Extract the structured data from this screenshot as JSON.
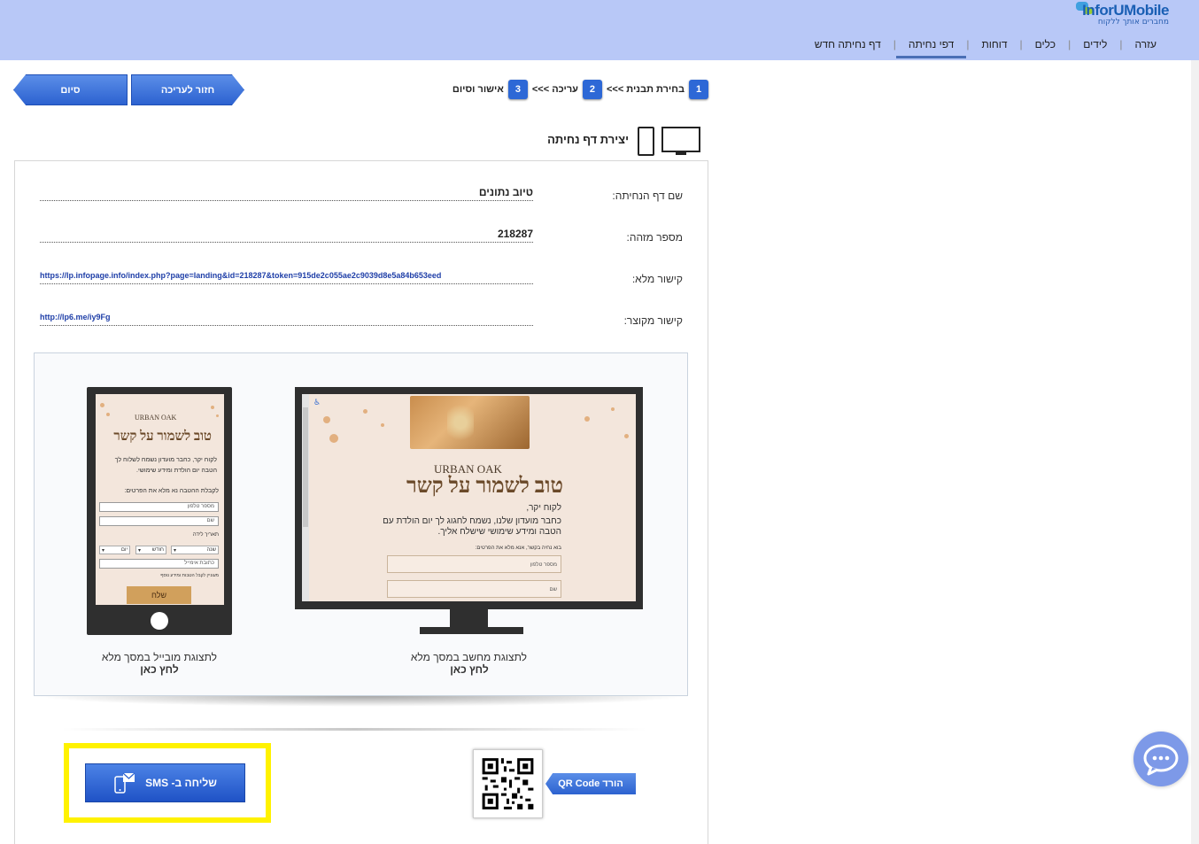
{
  "header": {
    "logo_text": "InforUMobile",
    "logo_sub": "מחברים אותך ללקוח",
    "nav": [
      {
        "label": "דף נחיתה חדש"
      },
      {
        "label": "דפי נחיתה",
        "active": true
      },
      {
        "label": "דוחות"
      },
      {
        "label": "כלים"
      },
      {
        "label": "לידים"
      },
      {
        "label": "עזרה"
      }
    ]
  },
  "toolbar": {
    "back_label": "חזור לעריכה",
    "finish_label": "סיום"
  },
  "steps": [
    {
      "num": "1",
      "label": "בחירת תבנית >>>"
    },
    {
      "num": "2",
      "label": "עריכה >>>"
    },
    {
      "num": "3",
      "label": "אישור וסיום"
    }
  ],
  "page_title": "יצירת דף נחיתה",
  "details": {
    "name_label": "שם דף הנחיתה:",
    "name_value": "טיוב נתונים",
    "id_label": "מספר מזהה:",
    "id_value": "218287",
    "full_link_label": "קישור מלא:",
    "full_link_value": "https://lp.infopage.info/index.php?page=landing&id=218287&token=915de2c055ae2c9039d8e5a84b653eed",
    "short_link_label": "קישור מקוצר:",
    "short_link_value": "http://lp6.me/iy9Fg"
  },
  "preview": {
    "brand": "URBAN OAK",
    "hero": "טוב לשמור על קשר",
    "desktop_greeting": "לקוח יקר,",
    "desktop_body_1": "כחבר מועדון שלנו, נשמח לחגוג לך יום הולדת עם",
    "desktop_body_2": "הטבה ומידע שימושי שישלח אליך.",
    "desktop_prompt": "בוא נחיה בקשר, אנא מלא את הפרטים:",
    "phone_placeholder": "מספר טלפון",
    "name_placeholder": "שם",
    "mobile_body_1": "לקוח יקר, כחבר מועדון נשמח לשלוח לך",
    "mobile_body_2": "הטבה יום הולדת ומידע שימושי.",
    "mobile_prompt": "לקבלת ההטבה נא מלא את הפרטים:",
    "birthday_label": "תאריך לידה",
    "year_label": "שנה",
    "month_label": "חודש",
    "day_label": "יום",
    "email_placeholder": "כתובת אימייל",
    "consent": "מעוניין לקבל הטבות ומידע נוסף",
    "submit_label": "שלח",
    "desktop_caption": "לתצוגת מחשב במסך מלא",
    "desktop_click": "לחץ כאן",
    "mobile_caption": "לתצוגת מובייל במסך מלא",
    "mobile_click": "לחץ כאן"
  },
  "actions": {
    "qr_label": "הורד QR Code",
    "sms_label": "שליחה ב- SMS"
  },
  "colors": {
    "header_bg": "#b8c8f7",
    "accent_blue": "#2c62d0",
    "highlight": "#fff200"
  }
}
